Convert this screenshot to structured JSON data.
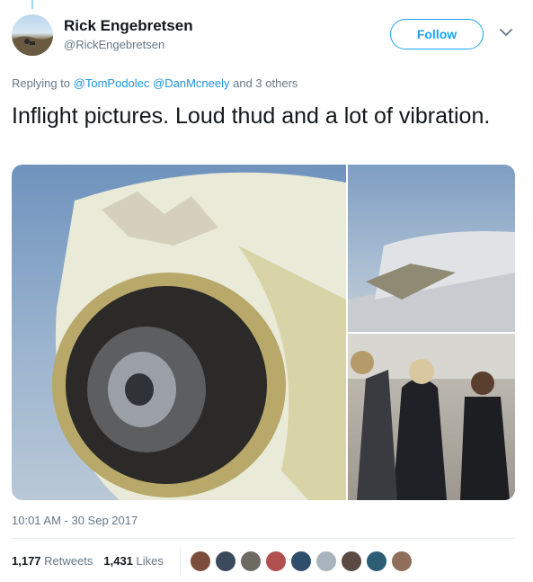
{
  "tweet": {
    "name": "Rick Engebretsen",
    "handle": "@RickEngebretsen",
    "follow_label": "Follow",
    "replying_prefix": "Replying to",
    "replying_mention_1": "@TomPodolec",
    "replying_mention_2": "@DanMcneely",
    "replying_suffix": "and 3 others",
    "text": "Inflight pictures. Loud thud and a lot of vibration.",
    "timestamp": "10:01 AM - 30 Sep 2017",
    "retweets_count": "1,177",
    "retweets_label": "Retweets",
    "likes_count": "1,431",
    "likes_label": "Likes"
  },
  "colors": {
    "accent": "#1da1f2",
    "mention": "#1b95e0",
    "muted": "#657786"
  },
  "icons": {
    "caret": "chevron-down-icon"
  },
  "likers": [
    "#7a4e3a",
    "#3b4a5c",
    "#6d6a62",
    "#b24f4f",
    "#2e4e6b",
    "#a8b3bd",
    "#5a4a43",
    "#2d5d73",
    "#8f6e5a"
  ]
}
